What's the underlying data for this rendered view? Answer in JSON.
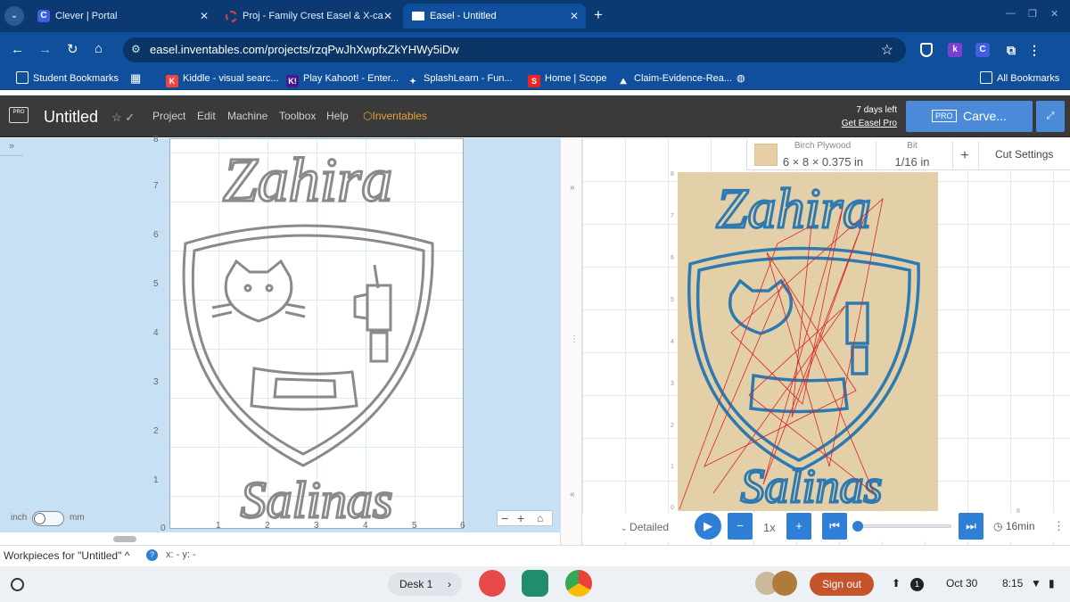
{
  "tabs": [
    {
      "title": "Clever | Portal",
      "favicon": "C",
      "color": "#3f5fe0"
    },
    {
      "title": "Proj - Family Crest Easel & X-ca",
      "favicon": "",
      "color": "#d33"
    },
    {
      "title": "Easel - Untitled",
      "favicon": "",
      "color": "#ffffff"
    }
  ],
  "address": {
    "url": "easel.inventables.com/projects/rzqPwJhXwpfxZkYHWy5iDw"
  },
  "bookmarks": [
    {
      "label": "Student Bookmarks"
    },
    {
      "label": "Kiddle - visual searc..."
    },
    {
      "label": "Play Kahoot! - Enter..."
    },
    {
      "label": "SplashLearn - Fun..."
    },
    {
      "label": "Home | Scope"
    },
    {
      "label": "Claim-Evidence-Rea..."
    },
    {
      "label": "All Bookmarks"
    }
  ],
  "easel": {
    "title": "Untitled",
    "menu": [
      "Project",
      "Edit",
      "Machine",
      "Toolbox",
      "Help"
    ],
    "inventables": "Inventables",
    "trial_days": "7 days left",
    "get_pro": "Get Easel Pro",
    "pro_badge": "PRO",
    "carve": "Carve...",
    "accent": "#4a8ad8"
  },
  "design": {
    "y_ticks": [
      "8",
      "7",
      "6",
      "5",
      "4",
      "3",
      "2",
      "1",
      "0"
    ],
    "x_ticks": [
      "1",
      "2",
      "3",
      "4",
      "5",
      "6"
    ],
    "unit_left": "inch",
    "unit_right": "mm",
    "crest_top_text": "Zahira",
    "crest_bottom_text": "Salinas"
  },
  "material": {
    "material_label": "Birch Plywood",
    "material_size": "6 × 8 × 0.375 in",
    "bit_label": "Bit",
    "bit_size": "1/16 in",
    "add": "+",
    "cut_settings": "Cut Settings"
  },
  "preview": {
    "y_ticks": [
      "8",
      "7",
      "6",
      "5",
      "4",
      "3",
      "2",
      "1",
      "0"
    ],
    "x_tick": "8"
  },
  "simulation": {
    "detailed": "Detailed",
    "speed": "1x",
    "progress": 0.0,
    "time": "16min"
  },
  "status": {
    "workpieces": "Workpieces for \"Untitled\"",
    "coords": "x: - y: -"
  },
  "shelf": {
    "desk": "Desk 1",
    "sign_out": "Sign out",
    "notif_count": "1",
    "date": "Oct 30",
    "time": "8:15"
  }
}
